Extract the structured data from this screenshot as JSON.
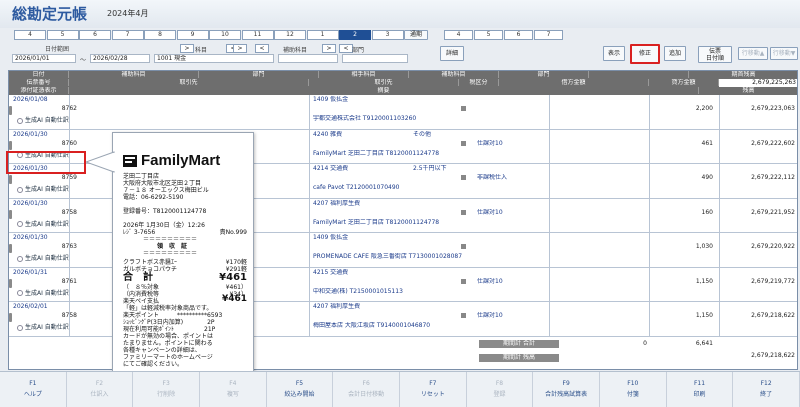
{
  "header": {
    "title": "総勘定元帳",
    "period": "2024年4月"
  },
  "month_tabs": [
    "4",
    "5",
    "6",
    "7",
    "8",
    "9",
    "10",
    "11",
    "12",
    "1",
    "2",
    "3"
  ],
  "selected_month": "2",
  "quarter_label": "通期",
  "quarter_tabs": [
    "4",
    "5",
    "6",
    "7"
  ],
  "filter": {
    "date_range_label": "日付範囲",
    "date_from": "2026/01/01",
    "date_tilde": "～",
    "date_to": "2026/02/28",
    "account_label": "科目",
    "account_value": "1001 現金",
    "sub_account_label": "補助科目",
    "dept_label": "部門",
    "prev": "<",
    "next": ">"
  },
  "toolbar": {
    "detail": "詳細",
    "display": "表示",
    "correct": "修正",
    "add": "追加",
    "slip_line1": "伝票",
    "slip_line2": "日付順",
    "up": "行移動▲",
    "down": "行移動▼"
  },
  "columns": {
    "r1": [
      "日付",
      "補助科目",
      "部門",
      "相手科目",
      "補助科目",
      "部門",
      "",
      "期首残高"
    ],
    "r2": [
      "伝票番号",
      "取引先",
      "取引先",
      "税区分",
      "借方金額",
      "貸方金額"
    ],
    "r3": [
      "添付証憑表示",
      "摘要",
      "残高"
    ],
    "opening_balance": "2,679,225,263"
  },
  "rows": [
    {
      "date": "2026/01/08",
      "no": "8762",
      "tag": "生成AI 自動仕訳",
      "acct": "1409 仮払金",
      "sub": "",
      "vendor": "宇都交通株式会社 T9120001103260",
      "tax": "",
      "debit": "",
      "credit": "2,200",
      "balance": "2,679,223,063"
    },
    {
      "date": "2026/01/30",
      "no": "8760",
      "tag": "生成AI 自動仕訳",
      "acct": "4240 雑費",
      "sub": "その他",
      "vendor": "FamilyMart 芝田二丁目店 T8120001124778",
      "tax": "仕課対10",
      "debit": "",
      "credit": "461",
      "balance": "2,679,222,602"
    },
    {
      "date": "2026/01/30",
      "no": "8759",
      "tag": "生成AI 自動仕訳",
      "acct": "4214 交通費",
      "sub": "2.5千円以下",
      "vendor": "cafe Pavot T2120001070490",
      "tax": "非課税仕入",
      "debit": "",
      "credit": "490",
      "balance": "2,679,222,112"
    },
    {
      "date": "2026/01/30",
      "no": "8758",
      "tag": "生成AI 自動仕訳",
      "acct": "4207 福利厚生費",
      "sub": "",
      "vendor": "FamilyMart 芝田二丁目店 T8120001124778",
      "tax": "仕課対10",
      "debit": "",
      "credit": "160",
      "balance": "2,679,221,952"
    },
    {
      "date": "2026/01/30",
      "no": "8763",
      "tag": "生成AI 自動仕訳",
      "acct": "1409 仮払金",
      "sub": "",
      "vendor": "PROMENADE CAFE 阪急三番街店 T7130001028087",
      "tax": "",
      "debit": "",
      "credit": "1,030",
      "balance": "2,679,220,922"
    },
    {
      "date": "2026/01/31",
      "no": "8761",
      "tag": "生成AI 自動仕訳",
      "acct": "4215 交通費",
      "sub": "",
      "vendor": "中和交通(株) T2150001015113",
      "tax": "仕課対10",
      "debit": "",
      "credit": "1,150",
      "balance": "2,679,219,772"
    },
    {
      "date": "2026/02/01",
      "no": "8758",
      "tag": "生成AI 自動仕訳",
      "acct": "4207 福利厚生費",
      "sub": "",
      "vendor": "梅田屋本店 大阪江坂店 T9140001046870",
      "tax": "仕課対10",
      "debit": "",
      "credit": "1,150",
      "balance": "2,679,218,622"
    }
  ],
  "footer": {
    "total_label": "期間計 合計",
    "total_debit": "0",
    "total_credit": "6,641",
    "sub_label": "期間計 残高",
    "ending_balance": "2,679,218,622"
  },
  "receipt": {
    "brand": "FamilyMart",
    "lines": [
      "芝田二丁目店",
      "大阪府大阪市北区芝田２丁目",
      "７－１８ オーエックス梅田ビル",
      "電話：06-6292-5190",
      "",
      "登録番号：T8120001124778",
      "",
      "2026年 1月30日（金）12:26",
      "",
      "＝＝＝＝＝＝＝＝＝",
      "領　収　証",
      "＝＝＝＝＝＝＝＝＝"
    ],
    "register": "ﾚｼﾞ 3-7656",
    "slip_no": "責No.999",
    "items": [
      {
        "name": "クラフトボス赤醤ｴｰ",
        "amount": "¥170軽"
      },
      {
        "name": "ガルボチョコパウチ",
        "amount": "¥291軽"
      }
    ],
    "total_label": "合　計",
    "total": "¥461",
    "tax_lines": [
      {
        "name": "（　８％対象",
        "amount": "¥461）"
      },
      {
        "name": "（内消費税等",
        "amount": "¥34）"
      },
      {
        "name": "楽天ペイ支払",
        "amount": "¥461"
      }
    ],
    "notes": [
      "「軽」は軽減税率対象商品です。",
      "楽天ポイント　　　**********6593",
      "ｼｮｯﾋﾟﾝｸﾞP(3日内加算)　　　　2P",
      "現在利用可能ﾎﾟｲﾝﾄ　　　　　21P",
      "カードが無効の場合、ポイントは",
      "たまりません。ポイントに関わる",
      "各種キャンペーンの詳細は、",
      "ファミリーマートのホームページ",
      "にてご確認ください。"
    ]
  },
  "fkeys": [
    {
      "key": "F1",
      "label": "ヘルプ",
      "enabled": true
    },
    {
      "key": "F2",
      "label": "仕訳入",
      "enabled": false
    },
    {
      "key": "F3",
      "label": "行削除",
      "enabled": false
    },
    {
      "key": "F4",
      "label": "複写",
      "enabled": false
    },
    {
      "key": "F5",
      "label": "絞込み開始",
      "enabled": true
    },
    {
      "key": "F6",
      "label": "会計日付移動",
      "enabled": false
    },
    {
      "key": "F7",
      "label": "リセット",
      "enabled": true
    },
    {
      "key": "F8",
      "label": "登録",
      "enabled": false
    },
    {
      "key": "F9",
      "label": "合計残高試算表",
      "enabled": true
    },
    {
      "key": "F10",
      "label": "付箋",
      "enabled": true
    },
    {
      "key": "F11",
      "label": "印刷",
      "enabled": true
    },
    {
      "key": "F12",
      "label": "終了",
      "enabled": true
    }
  ],
  "colors": {
    "accent": "#2d5aa0",
    "selected_tab": "#1f4f95",
    "highlight": "#d92020"
  }
}
